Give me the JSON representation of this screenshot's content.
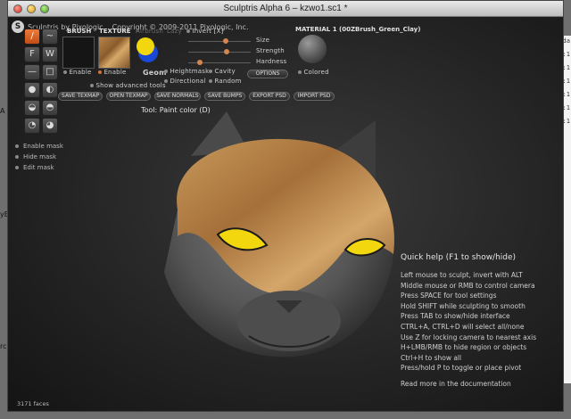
{
  "window": {
    "title": "Sculptris Alpha 6 – kzwo1.sc1 *"
  },
  "app": {
    "name": "Sculptris by Pixologic",
    "copyright": "Copyright © 2009-2011 Pixologic, Inc.",
    "logo_letter": "S"
  },
  "tools": {
    "items": [
      "/",
      "~",
      "F",
      "W",
      "—",
      "□",
      "●",
      "◐",
      "◒",
      "◓",
      "◔",
      "◕"
    ],
    "active_index": 0
  },
  "brush": {
    "label": "BRUSH",
    "enable": "Enable"
  },
  "texture": {
    "label": "TEXTURE",
    "enable": "Enable"
  },
  "modes": {
    "airbrush": "Airbrush",
    "lazy": "Lazy",
    "invert": "Invert [X]",
    "geom": "Geom"
  },
  "sliders": {
    "size": "Size",
    "strength": "Strength",
    "hardness": "Hardness",
    "size_value": 0.6,
    "strength_value": 0.62,
    "hardness_value": 0.18
  },
  "options": {
    "heightmask": "Heightmask",
    "cavity": "Cavity",
    "directional": "Directional",
    "random": "Random",
    "options_button": "OPTIONS",
    "show_advanced": "Show advanced tools"
  },
  "material": {
    "label": "MATERIAL 1 (00ZBrush_Green_Clay)",
    "colored": "Colored"
  },
  "buttons": [
    "SAVE TEXMAP",
    "OPEN TEXMAP",
    "SAVE NORMALS",
    "SAVE BUMPS",
    "EXPORT PSD",
    "IMPORT PSD"
  ],
  "tool_name": "Tool: Paint color (D)",
  "mask": {
    "enable": "Enable mask",
    "hide": "Hide mask",
    "edit": "Edit mask"
  },
  "quickhelp": {
    "title": "Quick help (F1 to show/hide)",
    "lines": [
      "Left mouse to sculpt, invert with ALT",
      "Middle mouse or RMB to control camera",
      "Press SPACE for tool settings",
      "Hold SHIFT while sculpting to smooth",
      "Press TAB to show/hide interface",
      "CTRL+A, CTRL+D will select all/none",
      "Use Z for locking camera to nearest axis",
      "H+LMB/RMB to hide region or objects",
      "Ctrl+H to show all",
      "Press/hold P to toggle or place pivot"
    ],
    "more": "Read more in the documentation"
  },
  "status": {
    "faces": "3171 faces"
  },
  "desktop": {
    "right_items": [
      "sda",
      "6:1",
      "6:1",
      "6:1",
      "6:1",
      "6:1",
      "6:1"
    ],
    "left_items": [
      "A",
      "yE",
      "rc"
    ]
  },
  "colors": {
    "accent": "#d8702f",
    "eyes": "#f2d70e",
    "fur": "#b88348",
    "skin": "#5b5b5b"
  }
}
